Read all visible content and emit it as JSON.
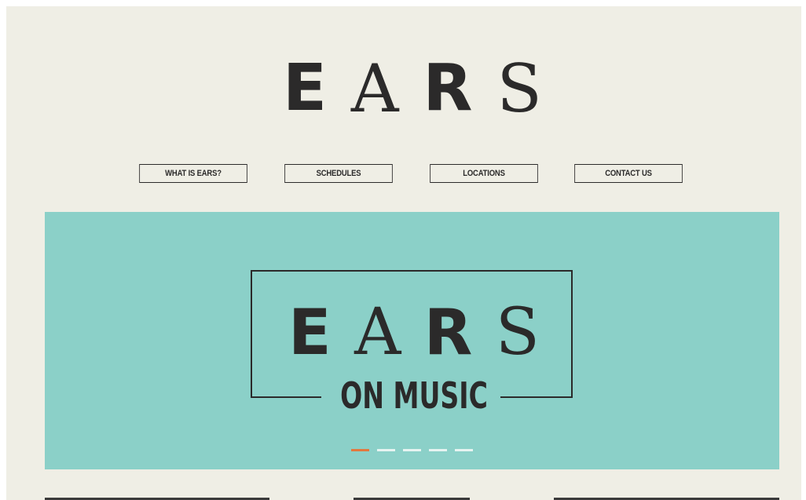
{
  "site": {
    "logo_letters": [
      "E",
      "A",
      "R",
      "S"
    ]
  },
  "nav": {
    "items": [
      {
        "label": "WHAT IS EARS?"
      },
      {
        "label": "SCHEDULES"
      },
      {
        "label": "LOCATIONS"
      },
      {
        "label": "CONTACT US"
      }
    ]
  },
  "hero": {
    "logo_letters": [
      "E",
      "A",
      "R",
      "S"
    ],
    "subtitle": "ON MUSIC",
    "slides_total": 5,
    "active_slide": 1,
    "colors": {
      "background": "#8bd0c8",
      "active_indicator": "#e2783f",
      "indicator": "#e6f3f1"
    }
  },
  "colors": {
    "page_background": "#efeee5",
    "text": "#2b2a2a"
  }
}
